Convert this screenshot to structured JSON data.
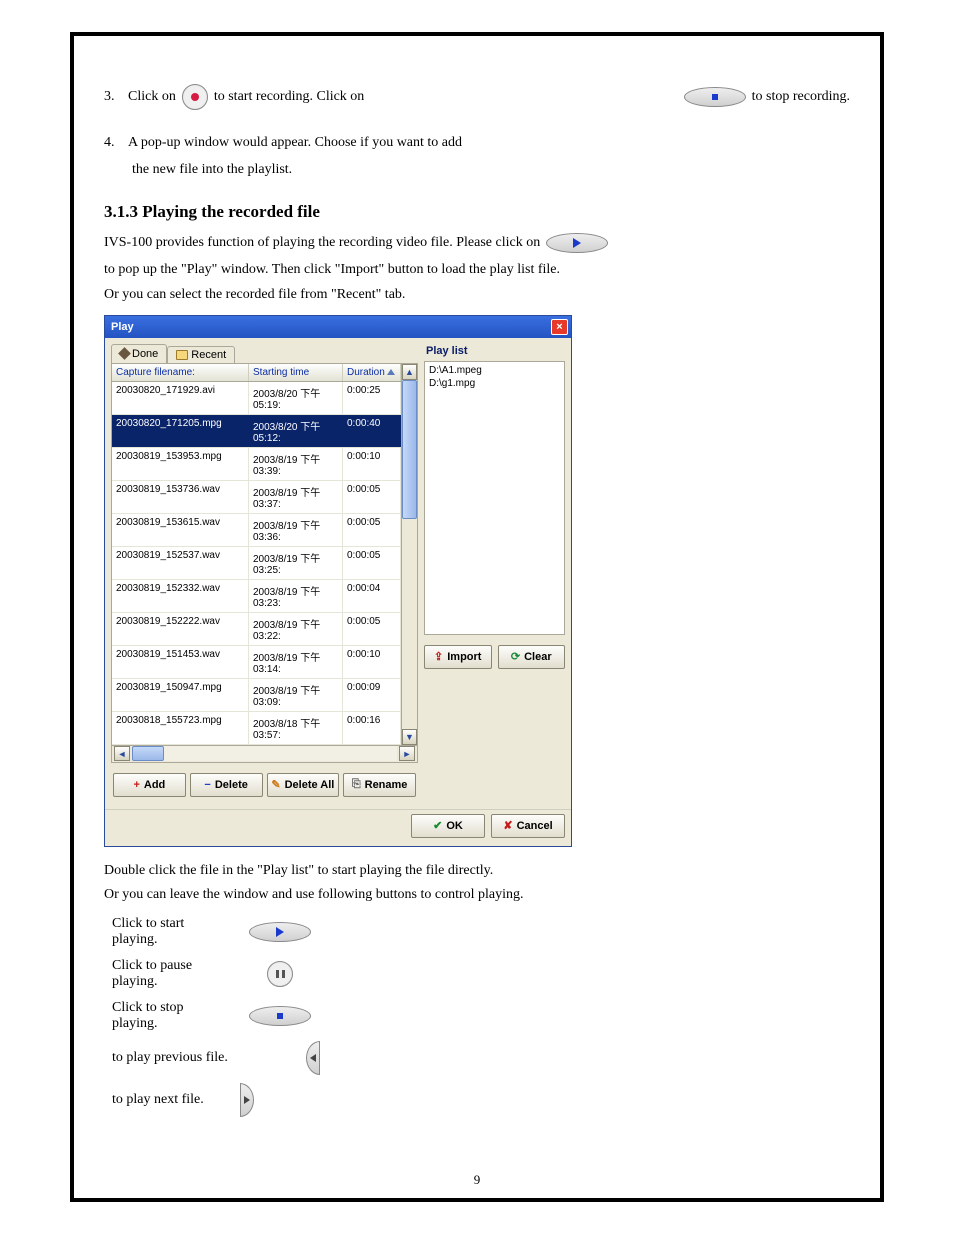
{
  "page": {
    "section_a_num": "3.",
    "rec_line_a": "Click on",
    "rec_line_b": "to start recording. Click on",
    "rec_line_c": "to stop recording.",
    "section_b_num": "4.",
    "section_b_text_a": "A pop-up window would appear.  Choose if you want to add",
    "section_b_text_b": "the new file into the playlist.",
    "heading_play": "3.1.3 Playing the recorded file",
    "play_intro_a": "IVS-100 provides function of playing the recording video file.  Please click on",
    "play_intro_b": "to pop up the \"Play\" window.  Then click \"Import\" button to load the play list file.",
    "play_intro_c": "Or you can select the recorded file from \"Recent\" tab.",
    "play_dialog": {
      "title": "Play",
      "tabs": {
        "done": "Done",
        "recent": "Recent"
      },
      "columns": {
        "c1": "Capture filename:",
        "c2": "Starting time",
        "c3": "Duration"
      },
      "rows": [
        {
          "f": "20030820_171929.avi",
          "t": "2003/8/20 下午 05:19:",
          "d": "0:00:25",
          "sel": false
        },
        {
          "f": "20030820_171205.mpg",
          "t": "2003/8/20 下午 05:12:",
          "d": "0:00:40",
          "sel": true
        },
        {
          "f": "20030819_153953.mpg",
          "t": "2003/8/19 下午 03:39:",
          "d": "0:00:10",
          "sel": false
        },
        {
          "f": "20030819_153736.wav",
          "t": "2003/8/19 下午 03:37:",
          "d": "0:00:05",
          "sel": false
        },
        {
          "f": "20030819_153615.wav",
          "t": "2003/8/19 下午 03:36:",
          "d": "0:00:05",
          "sel": false
        },
        {
          "f": "20030819_152537.wav",
          "t": "2003/8/19 下午 03:25:",
          "d": "0:00:05",
          "sel": false
        },
        {
          "f": "20030819_152332.wav",
          "t": "2003/8/19 下午 03:23:",
          "d": "0:00:04",
          "sel": false
        },
        {
          "f": "20030819_152222.wav",
          "t": "2003/8/19 下午 03:22:",
          "d": "0:00:05",
          "sel": false
        },
        {
          "f": "20030819_151453.wav",
          "t": "2003/8/19 下午 03:14:",
          "d": "0:00:10",
          "sel": false
        },
        {
          "f": "20030819_150947.mpg",
          "t": "2003/8/19 下午 03:09:",
          "d": "0:00:09",
          "sel": false
        },
        {
          "f": "20030818_155723.mpg",
          "t": "2003/8/18 下午 03:57:",
          "d": "0:00:16",
          "sel": false
        }
      ],
      "buttons_left": {
        "add": "Add",
        "delete": "Delete",
        "delete_all": "Delete All",
        "rename": "Rename"
      },
      "playlist": {
        "title": "Play list",
        "items": [
          "D:\\A1.mpeg",
          "D:\\g1.mpg"
        ]
      },
      "buttons_right": {
        "import": "Import",
        "clear": "Clear"
      },
      "buttons_bottom": {
        "ok": "OK",
        "cancel": "Cancel"
      }
    },
    "after_dialog": {
      "line_a": "Double click the file in the \"Play list\" to start playing the file directly.",
      "line_b": "Or you can leave the window and use following buttons to control playing.",
      "steps": [
        {
          "text": "Click to start playing.",
          "icon": "play"
        },
        {
          "text": "Click to pause playing.",
          "icon": "pause"
        },
        {
          "text": "Click to stop playing.",
          "icon": "stop"
        },
        {
          "text": "to play previous file.",
          "icon": "prev"
        },
        {
          "text": "to play next file.",
          "icon": "next"
        }
      ]
    },
    "page_number": "9"
  }
}
